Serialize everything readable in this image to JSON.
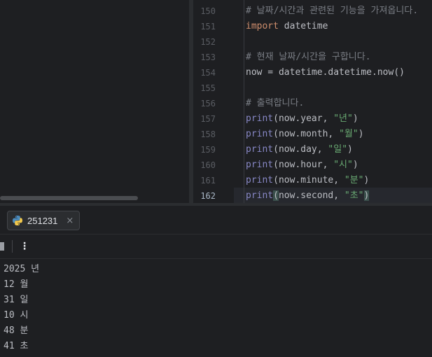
{
  "editor": {
    "line_numbers": [
      "150",
      "151",
      "152",
      "153",
      "154",
      "155",
      "156",
      "157",
      "158",
      "159",
      "160",
      "161",
      "162"
    ],
    "current_line": "162",
    "lines": {
      "l150": "# 날짜/시간과 관련된 기능을 가져옵니다.",
      "l151_kw": "import",
      "l151_rest": " datetime",
      "l153": "# 현재 날짜/시간을 구합니다.",
      "l154": "now = datetime.datetime.now()",
      "l156": "# 출력합니다.",
      "l157_fn": "print",
      "l157_args": "(now.year, ",
      "l157_str": "\"년\"",
      "l157_end": ")",
      "l158_fn": "print",
      "l158_args": "(now.month, ",
      "l158_str": "\"월\"",
      "l158_end": ")",
      "l159_fn": "print",
      "l159_args": "(now.day, ",
      "l159_str": "\"일\"",
      "l159_end": ")",
      "l160_fn": "print",
      "l160_args": "(now.hour, ",
      "l160_str": "\"시\"",
      "l160_end": ")",
      "l161_fn": "print",
      "l161_args": "(now.minute, ",
      "l161_str": "\"분\"",
      "l161_end": ")",
      "l162_fn": "print",
      "l162_open": "(",
      "l162_args": "now.second, ",
      "l162_str": "\"초\"",
      "l162_end": ")"
    }
  },
  "run_panel": {
    "tab_label": "251231",
    "tab_icon": "python-icon",
    "close_glyph": "×",
    "more_glyph": "⋮"
  },
  "console": {
    "output": [
      "2025 년",
      "12 월",
      "31 일",
      "10 시",
      "48 분",
      "41 초"
    ]
  },
  "colors": {
    "background": "#1e1f22",
    "keyword": "#cf8e6d",
    "builtin": "#8888c6",
    "string": "#6aab73",
    "comment": "#7a7e85"
  }
}
